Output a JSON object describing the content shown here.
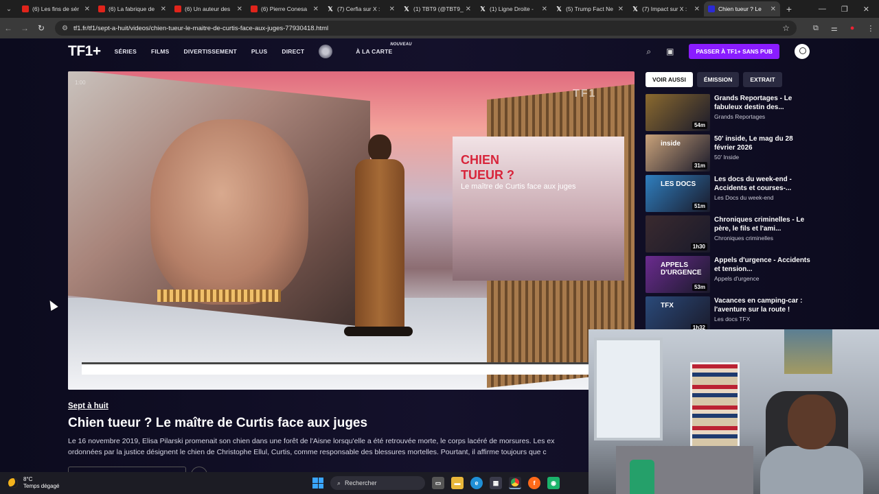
{
  "browser": {
    "tabs": [
      {
        "label": "(6) Les fins de sér",
        "icon": "youtube-icon",
        "type": "yt"
      },
      {
        "label": "(6) La fabrique de",
        "icon": "youtube-icon",
        "type": "yt"
      },
      {
        "label": "(6) Un auteur des",
        "icon": "youtube-icon",
        "type": "yt"
      },
      {
        "label": "(6) Pierre Conesa",
        "icon": "youtube-icon",
        "type": "yt"
      },
      {
        "label": "(7) Cerfia sur X :",
        "icon": "x-icon",
        "type": "x"
      },
      {
        "label": "(1) TBT9 (@TBT9_",
        "icon": "x-icon",
        "type": "x"
      },
      {
        "label": "(1) Ligne Droite -",
        "icon": "x-icon",
        "type": "x"
      },
      {
        "label": "(5) Trump Fact Ne",
        "icon": "x-icon",
        "type": "x"
      },
      {
        "label": "(7) Impact sur X :",
        "icon": "x-icon",
        "type": "x"
      },
      {
        "label": "Chien tueur ? Le",
        "icon": "tf1-icon",
        "type": "tf1",
        "active": true
      }
    ],
    "url": "tf1.fr/tf1/sept-a-huit/videos/chien-tueur-le-maitre-de-curtis-face-aux-juges-77930418.html"
  },
  "site": {
    "logo": "TF1+",
    "nav": [
      "SÉRIES",
      "FILMS",
      "DIVERTISSEMENT",
      "PLUS",
      "DIRECT"
    ],
    "a_la_carte": "À LA CARTE",
    "nouveau": "NOUVEAU",
    "cta": "PASSER À TF1+ SANS PUB",
    "accent_color": "#8a1cff"
  },
  "video": {
    "overlay_title": "CHIEN TUEUR ?",
    "overlay_subtitle": "Le maître de Curtis face aux juges",
    "channel_watermark": "TF1",
    "counter": "1:00"
  },
  "episode": {
    "show": "Sept à huit",
    "title": "Chien tueur ? Le maître de Curtis face aux juges",
    "synopsis_line1": "Le 16 novembre 2019, Elisa Pilarski promenait son chien dans une forêt de l'Aisne lorsqu'elle a été retrouvée morte, le corps lacéré de morsures. Les ex",
    "synopsis_line2": "ordonnées par la justice désignent le chien de Christophe Ellul, Curtis, comme responsable des blessures mortelles. Pourtant, il affirme toujours que c"
  },
  "sidebar": {
    "tabs": [
      "VOIR AUSSI",
      "ÉMISSION",
      "EXTRAIT"
    ],
    "items": [
      {
        "title": "Grands Reportages - Le fabuleux destin des...",
        "sub": "Grands Reportages",
        "duration": "54m",
        "thumb": "#8b6a2f"
      },
      {
        "title": "50' inside, Le mag du 28 février 2026",
        "sub": "50' Inside",
        "duration": "31m",
        "thumb": "#c9a27a",
        "thumb_text": "inside"
      },
      {
        "title": "Les docs du week-end - Accidents et courses-...",
        "sub": "Les Docs du week-end",
        "duration": "51m",
        "thumb": "#2f7fbf",
        "thumb_text": "LES DOCS"
      },
      {
        "title": "Chroniques criminelles - Le père, le fils et l'ami...",
        "sub": "Chroniques criminelles",
        "duration": "1h30",
        "thumb": "#3a2a2f"
      },
      {
        "title": "Appels d'urgence - Accidents et tension...",
        "sub": "Appels d'urgence",
        "duration": "53m",
        "thumb": "#6b2b8f",
        "thumb_text": "APPELS D'URGENCE"
      },
      {
        "title": "Vacances en camping-car : l'aventure sur la route !",
        "sub": "Les docs TFX",
        "duration": "1h32",
        "thumb": "#2a4a7a",
        "thumb_text": "TFX"
      }
    ]
  },
  "taskbar": {
    "temp": "8°C",
    "weather": "Temps dégagé",
    "search": "Rechercher"
  }
}
